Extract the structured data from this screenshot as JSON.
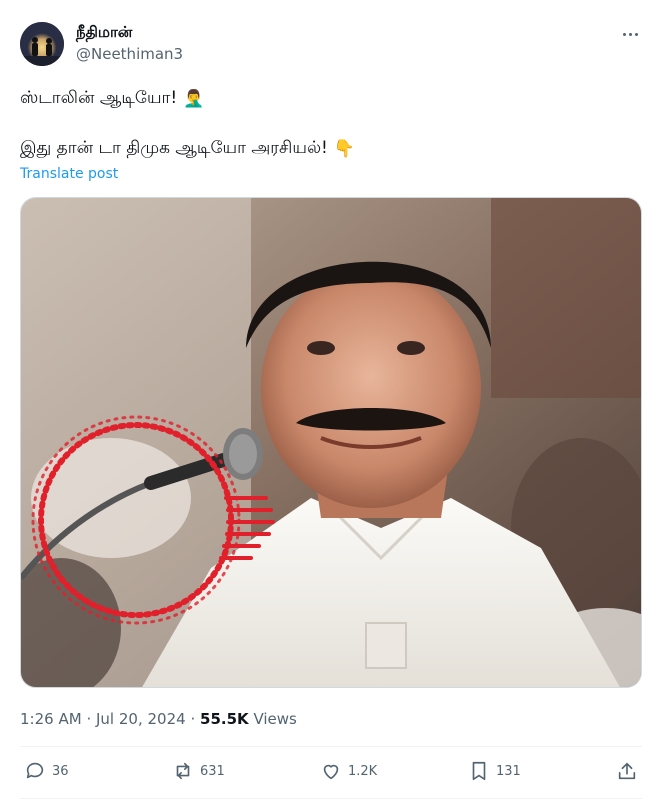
{
  "author": {
    "display_name": "நீதிமான்",
    "handle": "@Neethiman3"
  },
  "post": {
    "line1": "ஸ்டாலின் ஆடியோ!",
    "line1_emoji": "🤦‍♂️",
    "line2": "இது தான் டா திமுக ஆடியோ அரசியல்!",
    "line2_emoji": "👇",
    "translate_label": "Translate post"
  },
  "meta": {
    "time": "1:26 AM",
    "sep": "·",
    "date": "Jul 20, 2024",
    "sep2": "·",
    "views_count": "55.5K",
    "views_label": "Views"
  },
  "actions": {
    "replies": "36",
    "reposts": "631",
    "likes": "1.2K",
    "bookmarks": "131"
  },
  "icons": [
    "more-icon",
    "reply-icon",
    "repost-icon",
    "like-icon",
    "bookmark-icon",
    "share-icon"
  ],
  "colors": {
    "link": "#1d9bf0",
    "muted": "#536471",
    "text": "#0f1419",
    "audio_ring": "#e0202a"
  }
}
